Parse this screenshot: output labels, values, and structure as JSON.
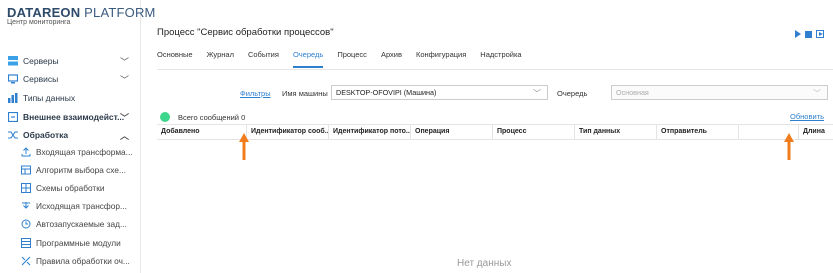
{
  "brand": {
    "name_bold": "DATAREON",
    "name_light": "PLATFORM",
    "subtitle": "Центр мониторинга"
  },
  "sidebar": {
    "items": [
      {
        "label": "Серверы",
        "chevron": "﹀"
      },
      {
        "label": "Сервисы",
        "chevron": "﹀"
      },
      {
        "label": "Типы данных"
      },
      {
        "label": "Внешнее взаимодейст...",
        "chevron": "﹀"
      },
      {
        "label": "Обработка",
        "chevron": "︿"
      },
      {
        "label": "Входящая трансформа..."
      },
      {
        "label": "Алгоритм выбора схе..."
      },
      {
        "label": "Схемы обработки"
      },
      {
        "label": "Исходящая трансфор..."
      },
      {
        "label": "Автозапускаемые зад..."
      },
      {
        "label": "Программные модули"
      },
      {
        "label": "Правила обработки оч..."
      }
    ]
  },
  "main": {
    "title": "Процесс \"Сервис обработки процессов\"",
    "tabs": [
      "Основные",
      "Журнал",
      "События",
      "Очередь",
      "Процесс",
      "Архив",
      "Конфигурация",
      "Надстройка"
    ],
    "active_tab": "Очередь",
    "filters_link": "Фильтры",
    "machine_label": "Имя машины",
    "machine_value": "DESKTOP-OFOVIPI (Машина)",
    "queue_label": "Очередь",
    "queue_placeholder": "Основная",
    "total_label": "Всего сообщений 0",
    "refresh_link": "Обновить",
    "columns": [
      "Добавлено",
      "Идентификатор сооб...",
      "Идентификатор пото...",
      "Операция",
      "Процесс",
      "Тип данных",
      "Отправитель",
      "",
      "Длина"
    ],
    "empty_text": "Нет данных"
  },
  "colors": {
    "accent": "#2f80d1",
    "status": "#3dd68c",
    "arrow": "#f07c1e"
  }
}
